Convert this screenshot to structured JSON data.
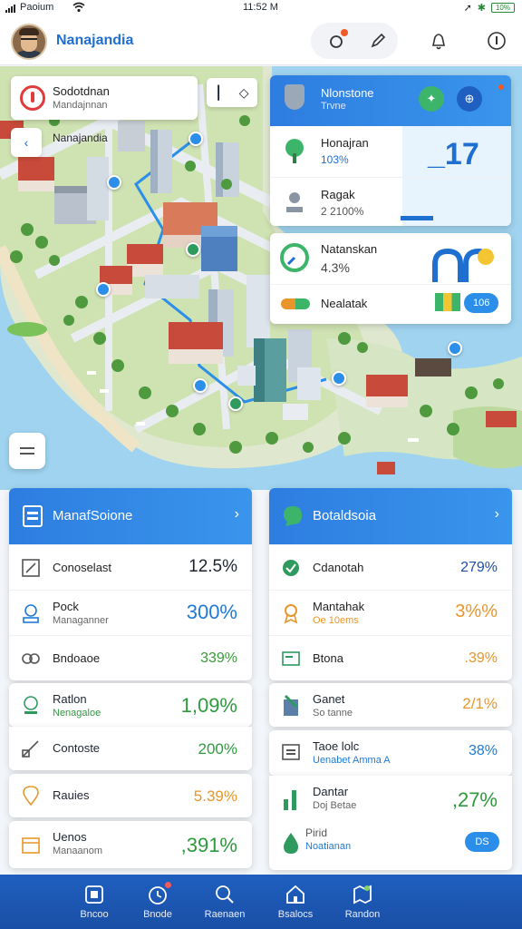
{
  "status_bar": {
    "carrier": "Paoium",
    "time": "11:52 M",
    "battery": "10%"
  },
  "header": {
    "app_title": "Nanajandia"
  },
  "map": {
    "location_card": {
      "title": "Sodotdnan",
      "subtitle": "Mandajnnan"
    },
    "subtitle_label": "Nanajandia"
  },
  "stats_panel": {
    "title": "Nlonstone",
    "subtitle": "Trvne",
    "rows": [
      {
        "label": "Honajran",
        "value": "103%",
        "value_color": "#1f6fd1"
      },
      {
        "label": "Ragak",
        "value": "2 2100%",
        "value_color": "#555555"
      }
    ],
    "big_value": "_17"
  },
  "metric_panel": {
    "row1_label": "Natanskan",
    "row1_value": "4.3%",
    "row2_label": "Nealatak",
    "row2_button": "106"
  },
  "left_card": {
    "title": "ManafSoione",
    "rows": [
      {
        "label": "Conoselast",
        "sub": "",
        "value": "12.5%",
        "color": "#1d2430"
      },
      {
        "label": "Pock",
        "sub": "Managanner",
        "value": "300%",
        "color": "#1f7ad8"
      },
      {
        "label": "Bndoaoe",
        "sub": "",
        "value": "339%",
        "color": "#3a9a3a"
      }
    ]
  },
  "right_card": {
    "title": "Botaldsoia",
    "rows": [
      {
        "label": "Cdanotah",
        "sub": "",
        "value": "279%",
        "color": "#1f4fa6"
      },
      {
        "label": "Mantahak",
        "sub": "Oe 10ems",
        "value": "3%%",
        "color": "#e8962a"
      },
      {
        "label": "Btona",
        "sub": "",
        "value": ".39%",
        "color": "#e8962a"
      }
    ]
  },
  "left_list": [
    {
      "label": "Ratlon",
      "sub": "Nenagaloe",
      "value": "1,09%",
      "color": "#2e9a3e",
      "sub_color": "#2e9a3e"
    },
    {
      "label": "Contoste",
      "sub": "",
      "value": "200%",
      "color": "#2e9a3e",
      "sub_color": "#666"
    },
    {
      "label": "Rauies",
      "sub": "",
      "value": "5.39%",
      "color": "#e8962a",
      "sub_color": "#666"
    },
    {
      "label": "Uenos",
      "sub": "Manaanom",
      "value": ",391%",
      "color": "#2e9a3e",
      "sub_color": "#666"
    }
  ],
  "right_list": [
    {
      "label": "Ganet",
      "sub": "So tanne",
      "value": "2/1%",
      "color": "#e8962a",
      "sub_color": "#666"
    },
    {
      "label": "Taoe lolc",
      "sub": "Uenabet Amma A",
      "value": "38%",
      "color": "#1f7ad8",
      "sub_color": "#1f7ad8"
    },
    {
      "label": "Dantar",
      "sub": "Doj Betae",
      "value": ",27%",
      "color": "#2e9a3e",
      "sub_color": "#666"
    },
    {
      "label": "Pirid",
      "sub": "Noatianan",
      "button": "DS",
      "sub_color": "#1f7ad8"
    }
  ],
  "bottom_nav": [
    {
      "label": "Bncoo",
      "icon": "home-icon"
    },
    {
      "label": "Bnode",
      "icon": "clock-icon"
    },
    {
      "label": "Raenaen",
      "icon": "search-icon"
    },
    {
      "label": "Bsalocs",
      "icon": "house-icon"
    },
    {
      "label": "Randon",
      "icon": "map-icon"
    }
  ]
}
